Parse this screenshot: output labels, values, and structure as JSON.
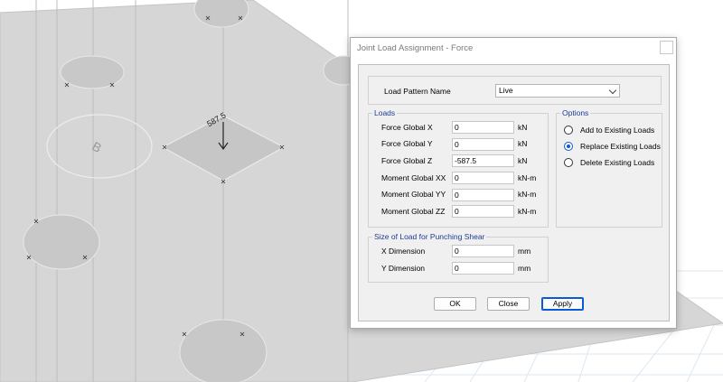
{
  "viewport": {
    "circle_label": "B",
    "load_value_label": "587.5"
  },
  "dialog": {
    "title": "Joint Load Assignment - Force",
    "load_pattern": {
      "label": "Load Pattern Name",
      "value": "Live"
    },
    "loads": {
      "title": "Loads",
      "rows": [
        {
          "label": "Force Global X",
          "value": "0",
          "unit": "kN"
        },
        {
          "label": "Force Global Y",
          "value": "0",
          "unit": "kN"
        },
        {
          "label": "Force Global Z",
          "value": "-587.5",
          "unit": "kN"
        },
        {
          "label": "Moment Global XX",
          "value": "0",
          "unit": "kN-m"
        },
        {
          "label": "Moment Global YY",
          "value": "0",
          "unit": "kN-m"
        },
        {
          "label": "Moment Global ZZ",
          "value": "0",
          "unit": "kN-m"
        }
      ]
    },
    "options": {
      "title": "Options",
      "items": [
        {
          "label": "Add to Existing Loads",
          "selected": false
        },
        {
          "label": "Replace Existing Loads",
          "selected": true
        },
        {
          "label": "Delete Existing Loads",
          "selected": false
        }
      ]
    },
    "punching": {
      "title": "Size of Load for Punching Shear",
      "rows": [
        {
          "label": "X Dimension",
          "value": "0",
          "unit": "mm"
        },
        {
          "label": "Y Dimension",
          "value": "0",
          "unit": "mm"
        }
      ]
    },
    "buttons": {
      "ok": "OK",
      "close": "Close",
      "apply": "Apply"
    }
  },
  "colors": {
    "accent": "#0a5bd3",
    "group_title": "#1c3c94",
    "slab": "#d6d6d6"
  }
}
